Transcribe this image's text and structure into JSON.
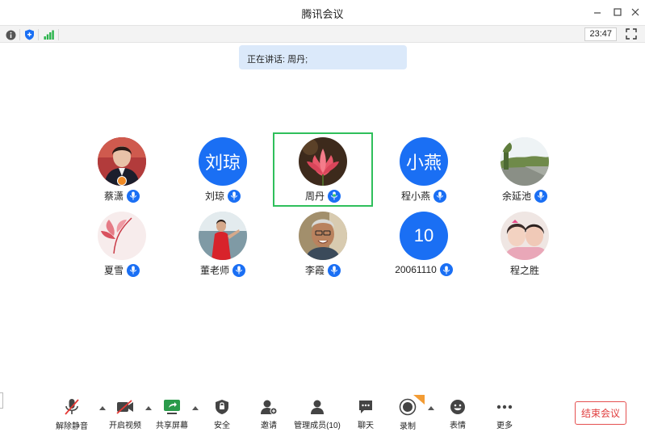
{
  "window": {
    "title": "腾讯会议"
  },
  "status": {
    "time": "23:47"
  },
  "speaking": {
    "text": "正在讲话: 周丹;"
  },
  "participants": [
    {
      "name": "蔡潇",
      "avatar_type": "photo-portrait"
    },
    {
      "name": "刘琼",
      "avatar_text": "刘琼"
    },
    {
      "name": "周丹",
      "avatar_type": "photo-lotus",
      "speaking": true
    },
    {
      "name": "程小燕",
      "avatar_text": "小燕"
    },
    {
      "name": "余延池",
      "avatar_type": "photo-landscape"
    },
    {
      "name": "夏雪",
      "avatar_type": "photo-feather"
    },
    {
      "name": "董老师",
      "avatar_type": "photo-seaside"
    },
    {
      "name": "李霞",
      "avatar_type": "photo-elder"
    },
    {
      "name": "20061110",
      "avatar_text": "10"
    },
    {
      "name": "程之胜",
      "avatar_type": "photo-kids",
      "mic": false
    }
  ],
  "toolbar": {
    "unmute": "解除静音",
    "video": "开启视频",
    "share": "共享屏幕",
    "security": "安全",
    "invite": "邀请",
    "members": "管理成员(10)",
    "chat": "聊天",
    "record": "录制",
    "reactions": "表情",
    "more": "更多",
    "end": "结束会议"
  },
  "colors": {
    "accent": "#1a6ff4",
    "speaking_border": "#2fbf5b",
    "end": "#e03d3d",
    "banner": "#dbe9fa"
  }
}
